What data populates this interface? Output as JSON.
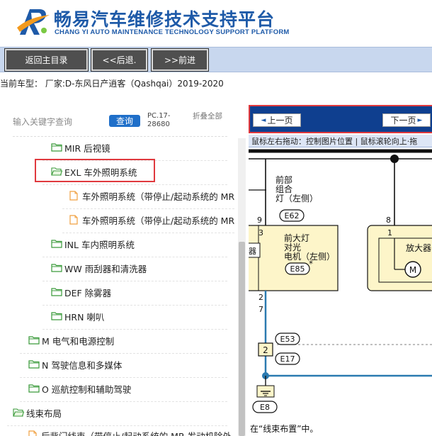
{
  "header": {
    "title": "畅易汽车维修技术支持平台",
    "subtitle": "CHANG YI AUTO MAINTENANCE TECHNOLOGY SUPPORT PLATFORM",
    "brand_color": "#1e5aa8"
  },
  "toolbar": {
    "home_label": "返回主目录",
    "back_label": "<<后退.",
    "forward_label": ">>前进"
  },
  "model_line": "当前车型： 厂家:D-东风日产逍客（Qashqai）2019-2020",
  "search": {
    "placeholder": "输入关键字查询",
    "button_label": "查询",
    "pc_text": "PC.17-28680",
    "fold_label": "折叠全部"
  },
  "tree": {
    "items": [
      {
        "label": "MIR 后视镜",
        "icon": "folder-icon"
      },
      {
        "label": "EXL 车外照明系统",
        "icon": "folder-open-icon"
      },
      {
        "label": "车外照明系统（带停止/起动系统的 MR",
        "icon": "document-icon"
      },
      {
        "label": "车外照明系统（带停止/起动系统的 MR",
        "icon": "document-icon"
      },
      {
        "label": "INL 车内照明系统",
        "icon": "folder-icon"
      },
      {
        "label": "WW 雨刮器和清洗器",
        "icon": "folder-icon"
      },
      {
        "label": "DEF 除雾器",
        "icon": "folder-icon"
      },
      {
        "label": "HRN 喇叭",
        "icon": "folder-icon"
      },
      {
        "label": "M 电气和电源控制",
        "icon": "folder-icon"
      },
      {
        "label": "N 驾驶信息和多媒体",
        "icon": "folder-icon"
      },
      {
        "label": "O 巡航控制和辅助驾驶",
        "icon": "folder-icon"
      },
      {
        "label": "线束布局",
        "icon": "folder-open-icon"
      },
      {
        "label": "后背门线束（带停止/起动系统的 MR 发动机除外",
        "icon": "document-icon"
      }
    ]
  },
  "viewer": {
    "prev_label": "上一页",
    "next_label": "下一页",
    "hint": "鼠标左右拖动：控制图片位置 | 鼠标滚轮向上·拖",
    "diagram": {
      "front_lamp_label": [
        "前部",
        "组合",
        "灯（左侧）"
      ],
      "e62": "E62",
      "pin9": "9",
      "pin8": "8",
      "pin3": "3",
      "pin1": "1",
      "pin2_top": "2",
      "pin7": "7",
      "pin2_box": "2",
      "headlamp_label": [
        "前大灯",
        "对光",
        "电机（左侧）"
      ],
      "e85": "E85",
      "star": "*",
      "amp_label": "放大器",
      "motor": "M",
      "left_cut": "器",
      "e53": "E53",
      "e17": "E17",
      "e8": "E8"
    },
    "note": "在“线束布置”中。"
  },
  "colors": {
    "toolbar_bg": "#c8d7ee",
    "button_bg": "#4f4f4f",
    "nav_bar_bg": "#0f3f8f",
    "highlight": "#e0393e",
    "wire_blue": "#2a7ab0",
    "box_fill": "#fdf5c9"
  }
}
